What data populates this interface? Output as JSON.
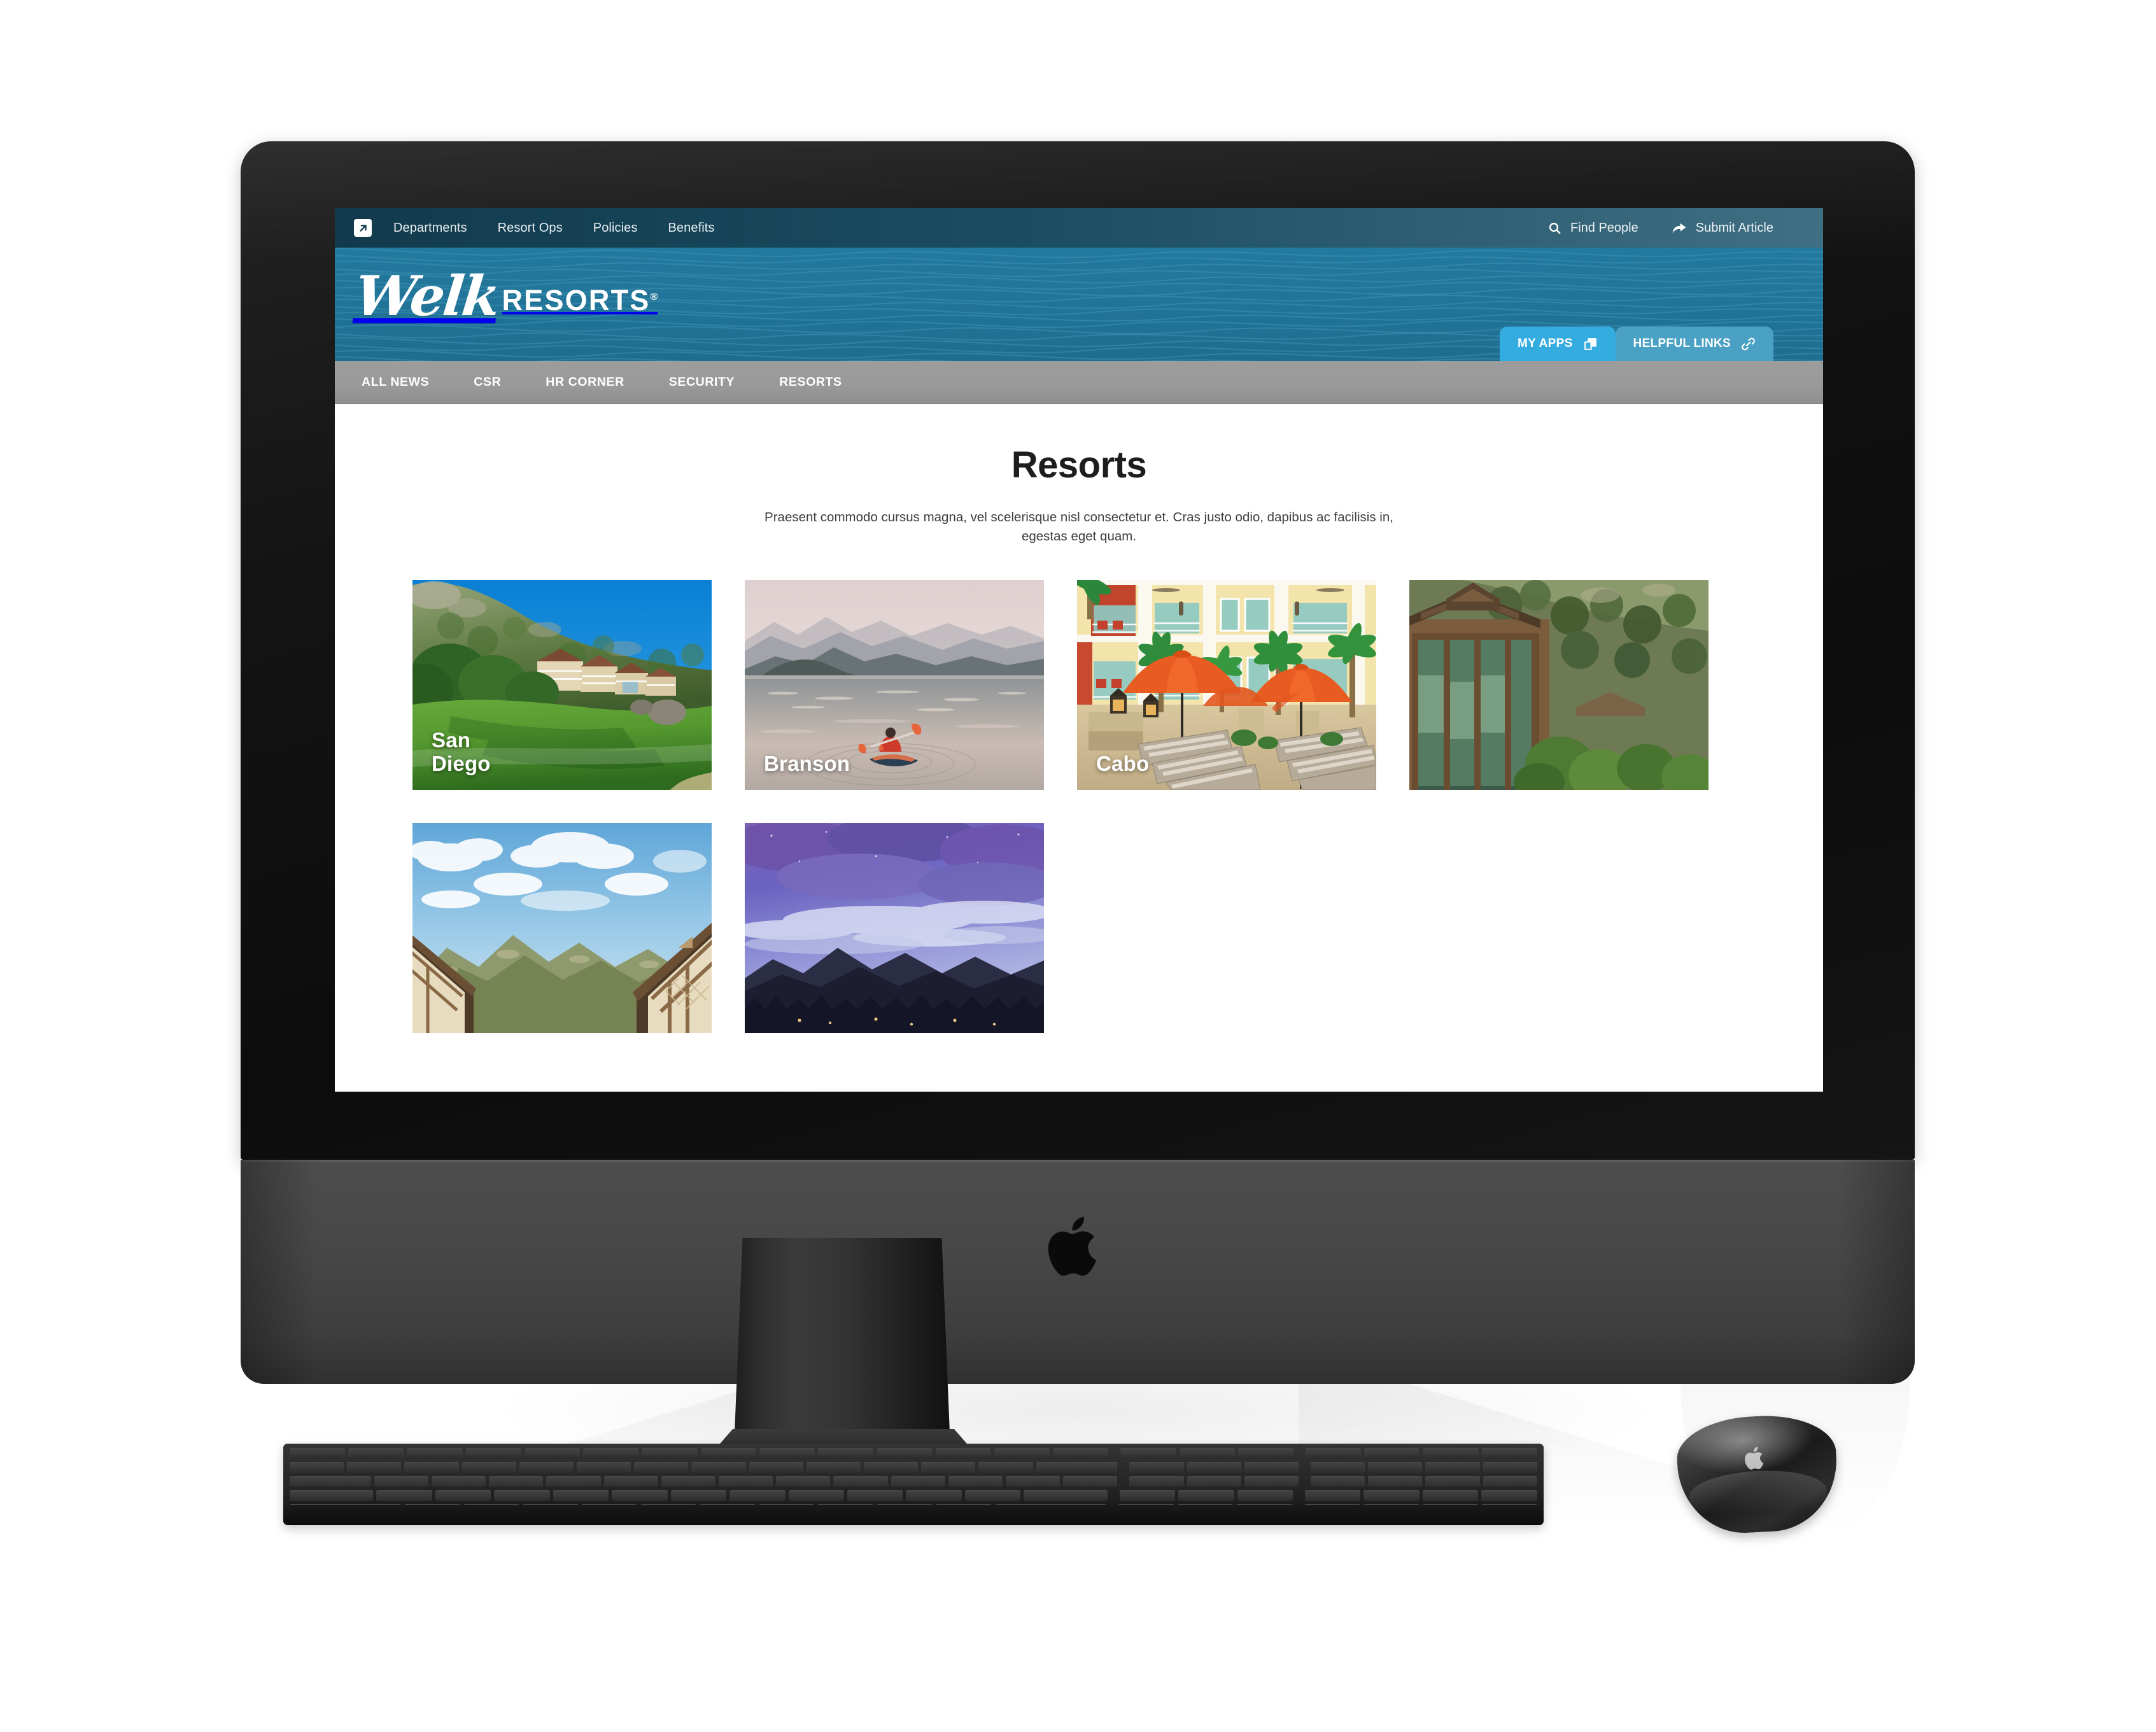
{
  "device": {
    "type": "imac-desktop",
    "apple_logo": "apple-logo",
    "peripherals": [
      "magic-keyboard",
      "magic-mouse"
    ]
  },
  "topnav": {
    "launch_icon": "external-link-icon",
    "links": [
      {
        "label": "Departments"
      },
      {
        "label": "Resort Ops"
      },
      {
        "label": "Policies"
      },
      {
        "label": "Benefits"
      }
    ],
    "actions": [
      {
        "label": "Find People",
        "icon": "search-icon"
      },
      {
        "label": "Submit Article",
        "icon": "share-arrow-icon"
      }
    ]
  },
  "brand": {
    "script_name": "Welk",
    "wordmark": "RESORTS",
    "registered_mark": "®",
    "band_color": "#217497",
    "topbar_color": "#1a4c60"
  },
  "pills": [
    {
      "label": "MY APPS",
      "icon": "windows-copy-icon",
      "color": "#35ACE0",
      "active": true
    },
    {
      "label": "HELPFUL LINKS",
      "icon": "link-chain-icon",
      "color": "#4AA1C4",
      "active": false
    }
  ],
  "section_nav": {
    "bar_color": "#999999",
    "items": [
      {
        "label": "ALL NEWS"
      },
      {
        "label": "CSR"
      },
      {
        "label": "HR CORNER"
      },
      {
        "label": "SECURITY"
      },
      {
        "label": "RESORTS"
      }
    ]
  },
  "page": {
    "title": "Resorts",
    "subtitle": "Praesent commodo cursus magna, vel scelerisque nisl consectetur et. Cras justo odio, dapibus ac facilisis in, egestas eget quam."
  },
  "resort_cards": [
    {
      "label": "San\nDiego",
      "art": "golf-course-hillside",
      "label_visible": true
    },
    {
      "label": "Branson",
      "art": "lake-kayaker-mountains",
      "label_visible": true
    },
    {
      "label": "Cabo",
      "art": "pool-deck-orange-umbrellas",
      "label_visible": true
    },
    {
      "label": "",
      "art": "timber-lodge-forest",
      "label_visible": false
    },
    {
      "label": "",
      "art": "chalet-roof-blue-sky-mountains",
      "label_visible": false
    },
    {
      "label": "",
      "art": "purple-twilight-mountains",
      "label_visible": false
    }
  ]
}
